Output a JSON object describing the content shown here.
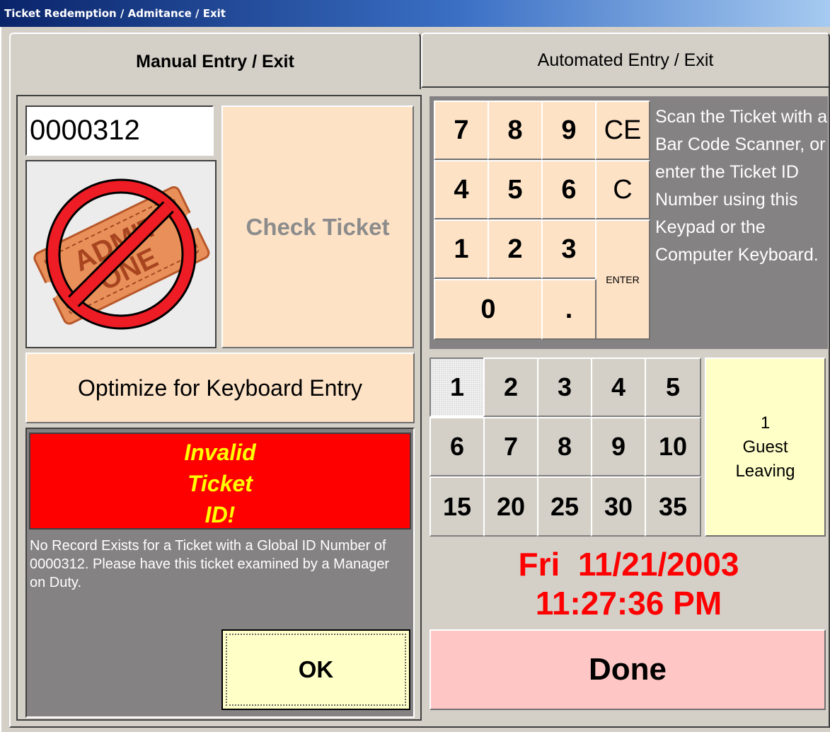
{
  "window": {
    "title": "Ticket Redemption / Admitance / Exit"
  },
  "tabs": [
    {
      "label": "Manual Entry / Exit",
      "active": true
    },
    {
      "label": "Automated Entry / Exit",
      "active": false
    }
  ],
  "manual": {
    "ticket_id_value": "0000312",
    "ticket_image": "no-admit-ticket-icon",
    "check_ticket_label": "Check Ticket",
    "optimize_label": "Optimize for Keyboard Entry",
    "status_lines": [
      "Invalid",
      "Ticket",
      "ID!"
    ],
    "message": "No Record Exists for a Ticket with a Global ID Number of 0000312.  Please have this ticket examined by a Manager on Duty.",
    "ok_label": "OK"
  },
  "keypad": {
    "keys": [
      "7",
      "8",
      "9",
      "CE",
      "4",
      "5",
      "6",
      "C",
      "1",
      "2",
      "3",
      "ENTER",
      "0",
      "."
    ],
    "instructions": "Scan the Ticket with a Bar Code Scanner, or enter the Ticket ID Number using this Keypad or the Computer Keyboard."
  },
  "guests": {
    "options": [
      "1",
      "2",
      "3",
      "4",
      "5",
      "6",
      "7",
      "8",
      "9",
      "10",
      "15",
      "20",
      "25",
      "30",
      "35"
    ],
    "selected": "1",
    "count": "1",
    "label_line1": "Guest",
    "label_line2": "Leaving"
  },
  "clock": {
    "date": "Fri  11/21/2003",
    "time": "11:27:36 PM"
  },
  "done_label": "Done",
  "colors": {
    "accent_peach": "#fde2c6",
    "alert_red": "#ff0000",
    "alert_text": "#ffff00",
    "ok_yellow": "#ffffc8",
    "done_pink": "#ffc6c6"
  }
}
